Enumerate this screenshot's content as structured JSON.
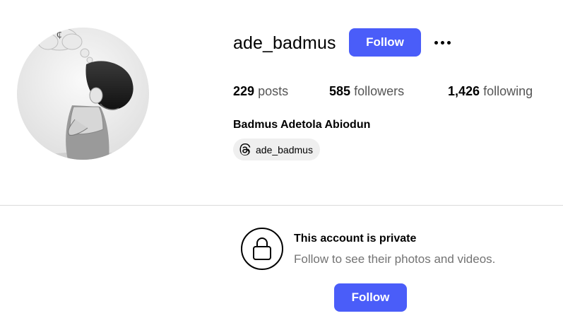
{
  "profile": {
    "username": "ade_badmus",
    "full_name": "Badmus Adetola Abiodun",
    "follow_label": "Follow",
    "more_icon": "more-options-icon",
    "stats": {
      "posts_count": "229",
      "posts_label": "posts",
      "followers_count": "585",
      "followers_label": "followers",
      "following_count": "1,426",
      "following_label": "following"
    },
    "threads": {
      "icon": "threads-icon",
      "handle": "ade_badmus"
    }
  },
  "private_notice": {
    "icon": "lock-icon",
    "title": "This account is private",
    "subtitle": "Follow to see their photos and videos.",
    "follow_label": "Follow"
  },
  "colors": {
    "accent": "#4a5df9",
    "divider": "#dbdbdb",
    "secondary_text": "#737373",
    "pill_bg": "#efefef"
  }
}
